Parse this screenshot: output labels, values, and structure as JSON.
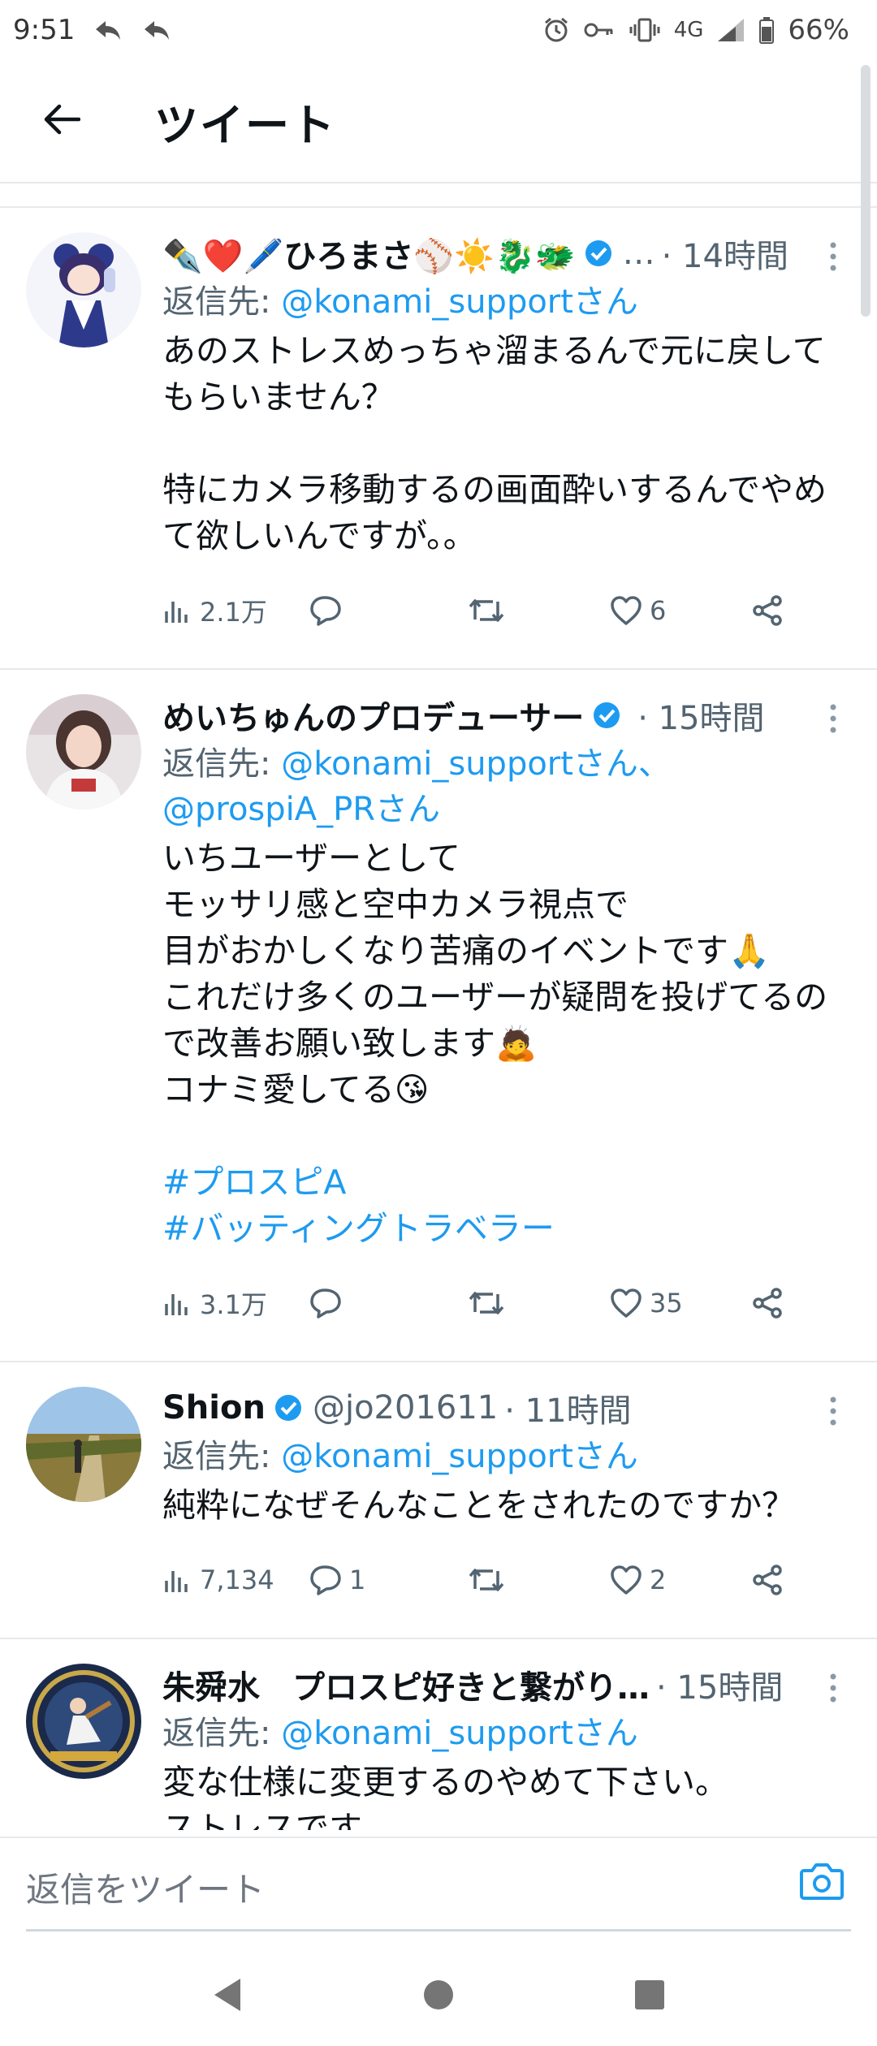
{
  "status_bar": {
    "time": "9:51",
    "network": "4G",
    "battery": "66%",
    "icons": [
      "reply-arrow-icon",
      "reply-arrow-icon",
      "alarm-icon",
      "key-icon",
      "vibrate-icon",
      "signal-icon",
      "battery-icon"
    ]
  },
  "header": {
    "title": "ツイート",
    "back_icon": "arrow-left-icon"
  },
  "tweets": [
    {
      "name": "✒️❤️🖊️ひろまさ⚾️☀️🐉🐲",
      "handle": "…",
      "time": "· 14時間",
      "reply_label": "返信先: ",
      "reply_mentions": "@konami_supportさん",
      "text": "あのストレスめっちゃ溜まるんで元に戻してもらいません？\n\n特にカメラ移動するの画面酔いするんでやめて欲しいんですが。。",
      "hashtags": "",
      "views": "2.1万",
      "replies": "",
      "retweets": "",
      "likes": "6"
    },
    {
      "name": "めいちゅんのプロデューサー",
      "handle": "",
      "time": "· 15時間",
      "reply_label": "返信先: ",
      "reply_mentions": "@konami_supportさん、@prospiA_PRさん",
      "text": "いちユーザーとして\nモッサリ感と空中カメラ視点で\n目がおかしくなり苦痛のイベントです🙏\nこれだけ多くのユーザーが疑問を投げてるので改善お願い致します🙇\nコナミ愛してる😘",
      "hashtags": "#プロスピA\n#バッティングトラベラー",
      "views": "3.1万",
      "replies": "",
      "retweets": "",
      "likes": "35"
    },
    {
      "name": "Shion",
      "handle": "@jo201611",
      "time": "· 11時間",
      "reply_label": "返信先: ",
      "reply_mentions": "@konami_supportさん",
      "text": "純粋になぜそんなことをされたのですか？",
      "hashtags": "",
      "views": "7,134",
      "replies": "1",
      "retweets": "",
      "likes": "2"
    },
    {
      "name": "朱舜水　プロスピ好きと繋がり…",
      "handle": "",
      "time": "· 15時間",
      "reply_label": "返信先: ",
      "reply_mentions": "@konami_supportさん",
      "text": "変な仕様に変更するのやめて下さい。\nストレスです。\n\n早急に今までの仕様に戻して下さい。",
      "hashtags": "",
      "views": "",
      "replies": "",
      "retweets": "",
      "likes": ""
    }
  ],
  "reply_bar": {
    "placeholder": "返信をツイート",
    "camera_icon": "camera-icon"
  },
  "nav_bar": {
    "icons": [
      "back-triangle-icon",
      "home-circle-icon",
      "recents-square-icon"
    ]
  },
  "colors": {
    "accent": "#1d9bf0",
    "text": "#0f1419",
    "secondary": "#536471",
    "divider": "#e6e9eb"
  }
}
